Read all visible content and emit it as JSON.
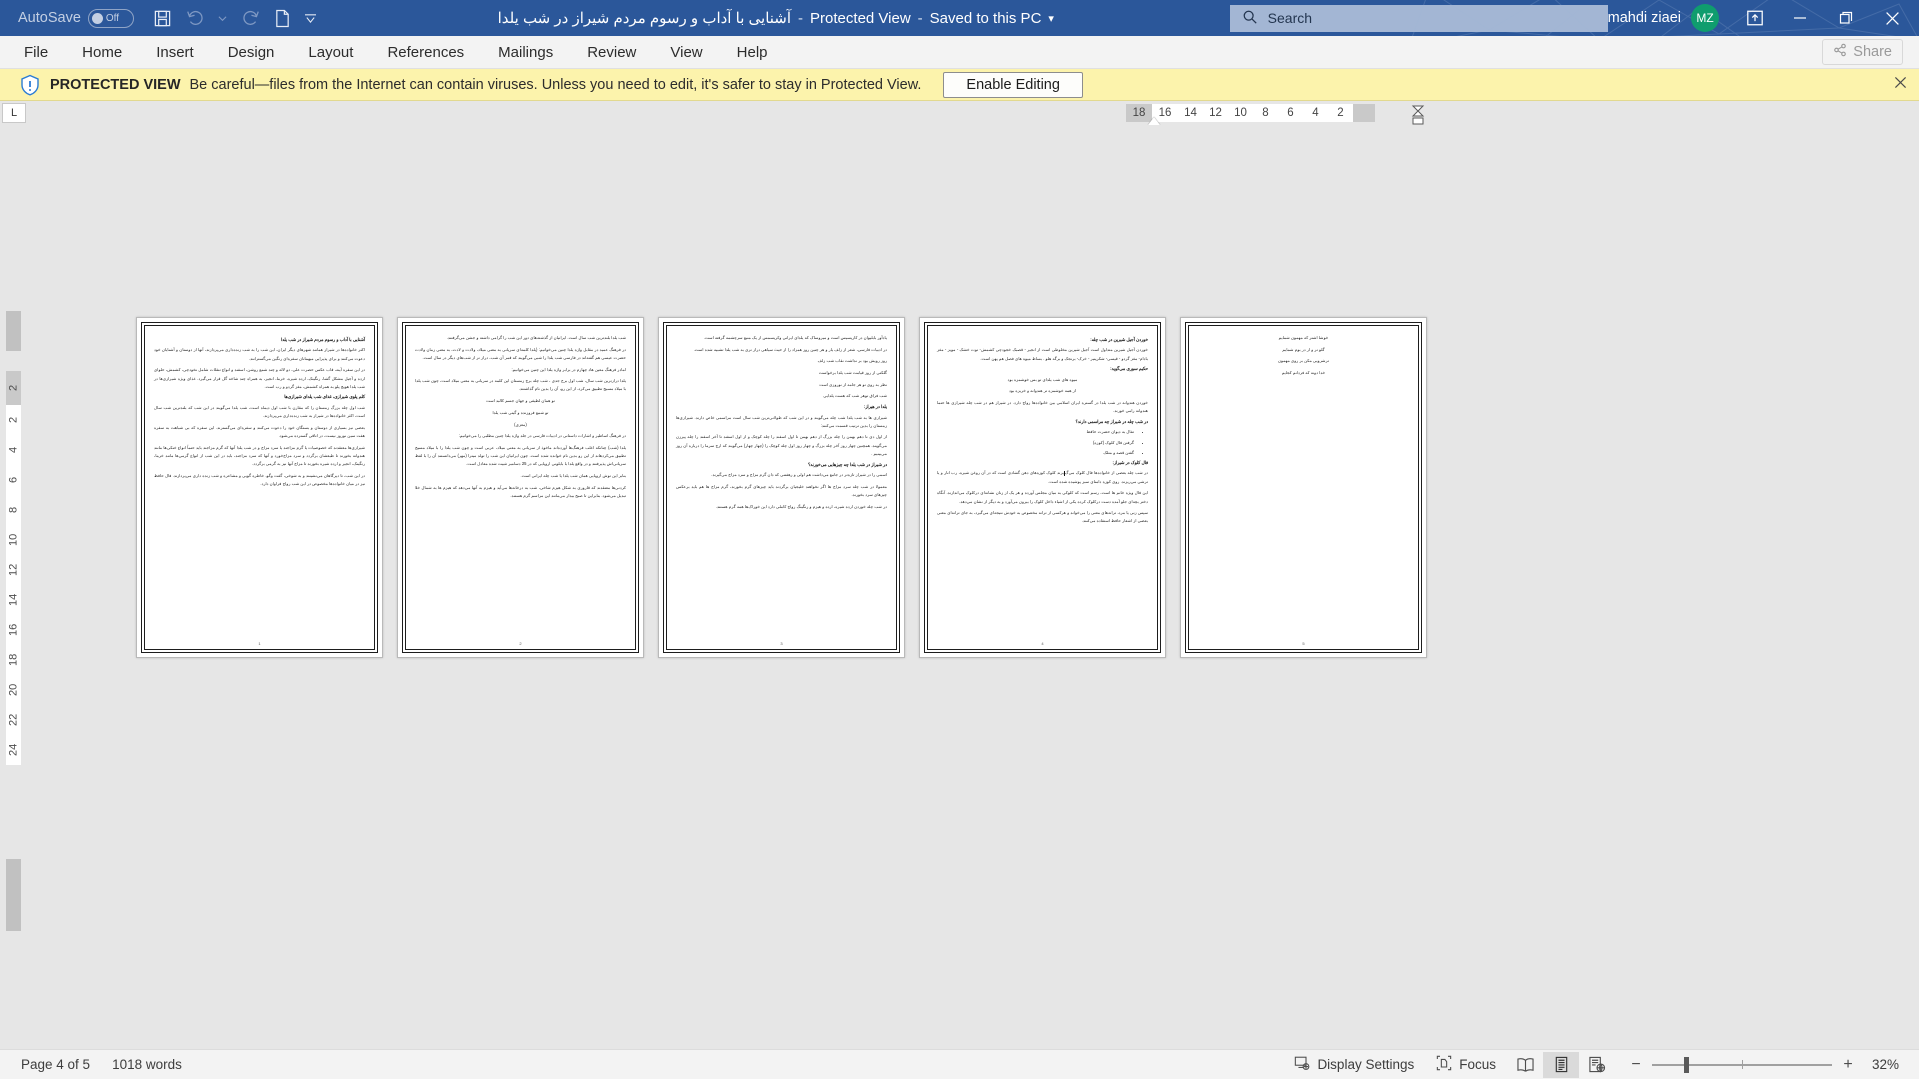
{
  "titlebar": {
    "autosave_label": "AutoSave",
    "autosave_state": "Off",
    "quick_access": [
      {
        "name": "save-icon",
        "label": "Save"
      },
      {
        "name": "undo-icon",
        "label": "Undo"
      },
      {
        "name": "undo-dropdown-icon",
        "label": "Undo options"
      },
      {
        "name": "redo-icon",
        "label": "Redo"
      },
      {
        "name": "new-file-icon",
        "label": "New"
      },
      {
        "name": "customize-quick-access-icon",
        "label": "Customize Quick Access Toolbar"
      }
    ],
    "document_name": "آشنایی با آداب و رسوم مردم شیراز در شب یلدا",
    "sep1": "-",
    "protected_view": "Protected View",
    "sep2": "-",
    "saved_state": "Saved to this PC",
    "title_dropdown": "▾",
    "search_placeholder": "Search",
    "search_icon": "search-icon",
    "user_name": "mahdi ziaei",
    "user_initials": "MZ",
    "ribbon_display_icon": "ribbon-display-options-icon",
    "minimize": "minimize-icon",
    "restore": "restore-icon",
    "close": "close-icon"
  },
  "ribbon": {
    "tabs": [
      {
        "label": "File"
      },
      {
        "label": "Home"
      },
      {
        "label": "Insert"
      },
      {
        "label": "Design"
      },
      {
        "label": "Layout"
      },
      {
        "label": "References"
      },
      {
        "label": "Mailings"
      },
      {
        "label": "Review"
      },
      {
        "label": "View"
      },
      {
        "label": "Help"
      }
    ],
    "share_label": "Share",
    "share_icon": "share-icon"
  },
  "protected_view": {
    "icon": "shield-info-icon",
    "strong": "PROTECTED VIEW",
    "message": "Be careful—files from the Internet can contain viruses. Unless you need to edit, it's safer to stay in Protected View.",
    "enable_button": "Enable Editing",
    "close_icon": "close-icon"
  },
  "ruler": {
    "tab_selector_glyph": "L",
    "horizontal_ticks": [
      "18",
      "16",
      "14",
      "12",
      "10",
      "8",
      "6",
      "4",
      "2"
    ],
    "vertical_ticks": [
      "2",
      "2",
      "4",
      "6",
      "8",
      "10",
      "12",
      "14",
      "16",
      "18",
      "20",
      "22",
      "24"
    ]
  },
  "document": {
    "pages": [
      {
        "number": "1",
        "blocks": [
          {
            "type": "h",
            "text": "آشنایی با آداب و رسوم مردم شیراز در شب یلدا"
          },
          {
            "type": "p",
            "text": "اکثر خانواده‌ها در شیراز همانند شهرهای دیگر ایران، این شب را به شب زنده‌داری می‌پردازند، آنها از دوستان و آشنایان خود دعوت می‌کنند و برای پذیرایی میهمانان سفره‌ای رنگین می‌گسترانند."
          },
          {
            "type": "p",
            "text": "در این سفره آینه، قاب عکس حضرت علی، دو لاله و چند شمع روشن، اسفند و انواع تنقلات شامل نخودچی، کشمش، حلوای ارده و آجیل مشکل گشا، رنگینک، ارده شیره، خرما، انجیر، به همراه چند شاخه گل قرار می‌گیرد. غذای ویژه شیرازی‌ها در شب یلدا هویج پلو به همراه کشمش، مغز گردو و رب است."
          },
          {
            "type": "h",
            "text": "کلم پلوی شیرازی، غذای شب یلدای شیرازی‌ها"
          },
          {
            "type": "p",
            "text": "شب اول چله بزرگ زمستان را که مقارن با شب اول دیماه است، شب یلدا می‌گویند در این شب که بلندترین شب سال است، اکثر خانواده‌ها در شیراز به شب زنده‌داری می‌پردازند."
          },
          {
            "type": "p",
            "text": "بعضی نیز بسیاری از دوستان و بستگان خود را دعوت می‌کنند و سفره‌ای می‌گسترند. این سفره که بی شباهت به سفره هفت سین نوروز نیست، در اتاقی گسترده می‌شود."
          },
          {
            "type": "p",
            "text": "شیرازی‌ها معتقدند که خصوصیات یا گرم مزاجند یا سرد مزاج و در شب یلدا آنها که گرم مزاجند باید حتماً انواع خنکی‌ها مانند هندوانه بخورند تا طبعشان برگردد و سرد مزاج‌خورد و آنها که سرد مزاجند، باید در این شب از انواع گرمی‌ها مانند خرما، رنگینک، انجیر و ارده شیره بخورند تا مزاج آنها نیز به گرمی برگردد."
          },
          {
            "type": "p",
            "text": "در این شب، تا دیرگاهان می‌نشینند و به شوخی، گفت وگو، خاطره گویی و مشاعره و شب زنده داری می‌پردازند. فال حافظ نیز در میان خانواده‌ها مخصوص در این شب رواج فراوان دارد."
          }
        ]
      },
      {
        "number": "2",
        "blocks": [
          {
            "type": "p",
            "text": "شب یلدا بلندترین شب سال است. ایرانیان از گذشته‌های دور این شب را گرامی داشته و جشن می‌گرفتند."
          },
          {
            "type": "p",
            "text": "در فرهنگ عمید در مقابل واژه یلدا چنین می‌خوانیم: (یلدا کلمه‌ای سریانی به معنی میلاد، ولادت و لادت، به معنی زمان ولادت حضرت عیسی هم گفته‌اند در فارسی شب یلدا را شبی می‌گویند که قمر آن شب، دراز تر از شب‌های دیگر در سال است."
          },
          {
            "type": "p",
            "text": "امادر فرهنگ معین هاد چهارم در برابر واژه یلدا این چنین می‌خوانیم:"
          },
          {
            "type": "p",
            "text": "یلدا درازترین شب سال، شب اول برج جدی ، شب چله برج زمستان این کلمه در سریانی به معنی میلاد است، چون شب یلدا با میلاد مسیح تطبیق می‌کرد، از این رو، آن را بدین نام گذاشتند."
          },
          {
            "type": "p",
            "c": true,
            "text": "تو همان لطیفی و جهان جسم کالبد است"
          },
          {
            "type": "p",
            "c": true,
            "text": "تو شمع فروزنده و گیتی شب یلدا"
          },
          {
            "type": "p",
            "c": true,
            "text": "(معزی)"
          },
          {
            "type": "p",
            "text": "در فرهنگ اساطیر و اشارات داستانی در ادبیات فارسی در جلد واژه یلدا چنین مطلبی را می‌خوانیم:"
          },
          {
            "type": "p",
            "text": "یلدا (شب) چنانکه اغلب فرهنگ‌ها آورده‌اند ماخوذ از سریانی به معنی میلاد، عربی است و چون شب یلدا را با میلاد مسیح تطبیق می‌کردهاند از این رو بدین نام خوانده شده است. چون ایرانیان این شب را تولد میترا (مهر) می‌دانستند آن را با لفظ سریانی‌اش پذیرفتند و در واقع یلدا با بابلونی اروپایی که در 25 دسامبر تثبیت شده معادل است."
          },
          {
            "type": "p",
            "text": "بنابر این توش اروپایی همان شب یلدا یا شب چله ایرانی است."
          },
          {
            "type": "p",
            "text": "کردنی‌ها معتقدند که قاروری به شکل هیزم شاخی، شب به درخانه‌ها می‌آید و هیزم به آنها می‌دهد که هیزم ها به شمال خلا تبدیل می‌شود. بنابراین تا صبح بیدار می‌مانند این مراسم گرم هستند."
          }
        ]
      },
      {
        "number": "3",
        "blocks": [
          {
            "type": "p",
            "text": "یادآور بابلیوان در کاریسیس است و میروساک که یلدای ایرانی وکریسمس از یک منبع سرچشمه گرفته است."
          },
          {
            "type": "p",
            "text": "در ادبیات فارسی، شعر از زلف یار و هر چنین روز همزاد را از حیث سیاهی دراز تری به شب یلدا تشبیه شده است."
          },
          {
            "type": "p",
            "text": "روز رویش بود بر نداشت نقاب شب زلف"
          },
          {
            "type": "p",
            "text": "گلکتی از روز قیامت شب یلدا برخواست"
          },
          {
            "type": "p",
            "text": "نظر به روی تو هر جامه از نوروزی است"
          },
          {
            "type": "p",
            "text": "شب فراق توهر شب که هست یلدایی"
          },
          {
            "type": "h",
            "text": "یلدا در هیراز:"
          },
          {
            "type": "p",
            "text": "شیرازی ها به شب یلدا شب چله می‌گویند و در این شب که طولانی‌ترین شب سال است مراسمی خاص دارند. شیرازی‌ها زمستان را بدین ترتیب قسمت می‌کنند:"
          },
          {
            "type": "p",
            "text": "از اول دی تا دهم بهمن را چله بزرگ از دهم بهمن تا اول اسفند را چله کوچک و از اول اسفند تا آخر اسفند را چله پیرزن می‌گویند. همچنین چهار روز آخر چله بزرگ و چهار روز اول چله کوچک را (چهار چهار) می‌گویند که ارج سرما را درباره آن روز می‌بینیم ."
          },
          {
            "type": "h",
            "text": "در شیراز در شب یلدا چه چیزهایی می‌خورند؟"
          },
          {
            "type": "p",
            "text": "اسمی را در شیراز تازه‌تر در جامع می‌داشت هم اولی و رهفتنی که دان گرم مزاج و سرد مزاج می‌گیرند."
          },
          {
            "type": "p",
            "text": "معمولا در شب چله سرد مزاج ها اگر نخواهند خلیجیان برگردند باید چیزهای گرم بخورند، گرم مزاج ها هم باید برعکس چیزهای سرد بخورند."
          },
          {
            "type": "p",
            "text": "در شب چله خوردن ارده شیره، ارده و هیزم و رنگینگ رواج کاملی دارد این خوراک‌ها همه گرم هستند."
          }
        ]
      },
      {
        "number": "4",
        "blocks": [
          {
            "type": "h",
            "text": "خوردن آجیل شیرین در شب چله:"
          },
          {
            "type": "p",
            "text": "خوردن آجیل شیرین متداول است آجیل شیرین مخلوطی است از انجیر - قصبک خجودچی کشمش- توت خشک - مویز - مغز بادام- مغز گردو - قیسی- شکرپنیر - خرک- برنجک و برگه هلو . بساط میوه های فصل هم پهن است."
          },
          {
            "type": "h",
            "text": "حکیم سوری می‌گوید:"
          },
          {
            "type": "p",
            "c": true,
            "text": "میوه های شب یلدای تو بس خوشمزه بود"
          },
          {
            "type": "p",
            "c": true,
            "text": "از همه خوشمزه تر هندوانه و خربزه بود"
          },
          {
            "type": "p",
            "text": "خوردن هندوانه در شب یلدا در گستره ایران اسلامی بین خانواده‌ها رواج دارد. در شیراز هم در شب چله شیرازی ها حتما هندوانه رامی خورند."
          },
          {
            "type": "h",
            "text": "در شب چله در شیراز چه مراسمی دارند؟"
          },
          {
            "type": "li",
            "text": "تفال به دیوان حضرت حافظ"
          },
          {
            "type": "li",
            "text": "گرفتن فال کلوک (کوزه)"
          },
          {
            "type": "li",
            "text": "گفتن قصه و متلک"
          },
          {
            "type": "h",
            "text": "فال کلوک در شیراز:"
          },
          {
            "type": "p",
            "text": "در شب چله بعضی از خانواده‌ها فال کلوک می‌گیرند کلوک کوزه‌های دهن گشادی است که در آن روغن شیره، رب انار و یا ترشی می‌ریزند. روی کوزه دامنای سبز پوشیده شده است.",
            "caret_after": 42
          },
          {
            "type": "p",
            "text": "این فال ویژه خانم ها است، رسم است که کلوکی به میان مجلس آورده و هر یک از زنان نشانه‌ای درکلوک می‌اندازند. آنگاه دختر بچه‌ای جلو آمده دست درکلوک کرده یکی از اشیاء داخل کلوک را بیرون می‌آورد و به دیگر از نشان می‌دهد."
          },
          {
            "type": "p",
            "text": "سپس زنی یا مرد، ترانه‌های معنی را می‌خواند و هرکسی از ترانه مخصوص به خودش نتیجه‌ای می‌گیرد، به جای ترانه‌ای معنی بعضی از اشعار حافظ استفاده می‌کنند."
          }
        ]
      },
      {
        "number": "5",
        "blocks": [
          {
            "type": "p",
            "c": true,
            "text": "خوشا اشتر که مهمون شمایم"
          },
          {
            "type": "p",
            "c": true,
            "text": "گلو تر و ار در بوم شمایم"
          },
          {
            "type": "p",
            "c": true,
            "text": "ترشرویی مکن بر روی مهمون"
          },
          {
            "type": "p",
            "c": true,
            "text": "خدا دونه که فردانم کجایم"
          }
        ]
      }
    ]
  },
  "statusbar": {
    "page_label": "Page 4 of 5",
    "word_count": "1018 words",
    "display_settings": "Display Settings",
    "display_settings_icon": "display-settings-icon",
    "focus": "Focus",
    "focus_icon": "focus-icon",
    "view_read_icon": "read-mode-icon",
    "view_print_icon": "print-layout-icon",
    "view_web_icon": "web-layout-icon",
    "zoom_out": "−",
    "zoom_in": "+",
    "zoom_level": "32%"
  },
  "colors": {
    "titlebar": "#2b579a",
    "accent": "#2b579a",
    "avatar": "#0f9d6e",
    "protected_bar": "#fcf3ac",
    "canvas": "#e6e6e6"
  }
}
